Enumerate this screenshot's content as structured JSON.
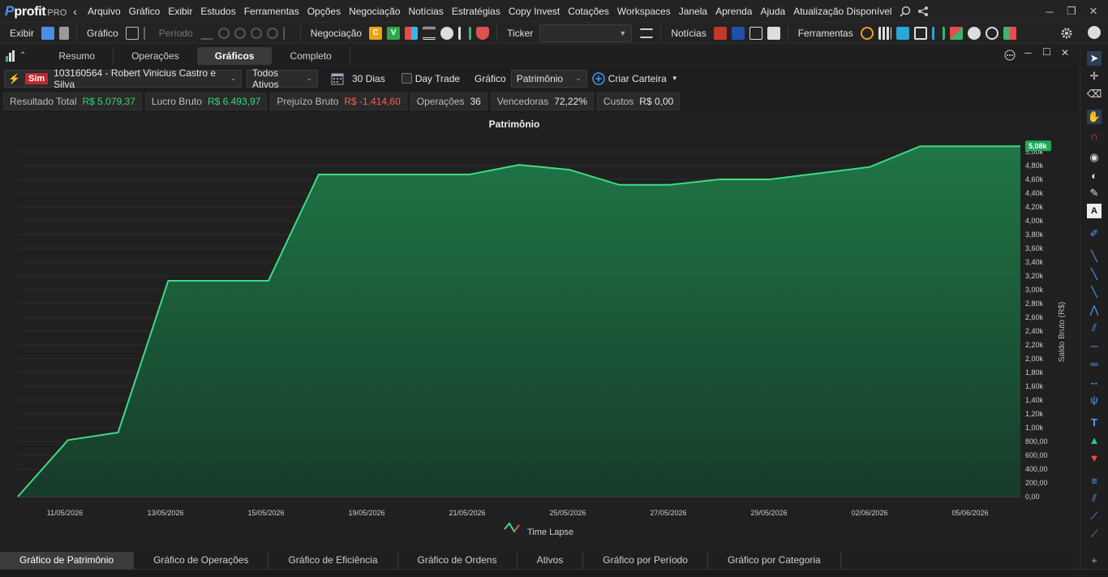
{
  "menubar": {
    "logo_main": "profit",
    "logo_sub": "PRO",
    "items": [
      "Arquivo",
      "Gráfico",
      "Exibir",
      "Estudos",
      "Ferramentas",
      "Opções",
      "Negociação",
      "Notícias",
      "Estratégias",
      "Copy Invest",
      "Cotações",
      "Workspaces",
      "Janela",
      "Aprenda",
      "Ajuda",
      "Atualização Disponível"
    ]
  },
  "toolbar": {
    "exibir": "Exibir",
    "grafico": "Gráfico",
    "periodo": "Período",
    "negociacao": "Negociação",
    "ticker": "Ticker",
    "noticias": "Notícias",
    "ferramentas": "Ferramentas",
    "btn_c": "C",
    "btn_v": "V"
  },
  "tabs": [
    "Resumo",
    "Operações",
    "Gráficos",
    "Completo"
  ],
  "active_tab": "Gráficos",
  "filters": {
    "sim": "Sim",
    "account": "103160564 - Robert Vinicius Castro e Silva",
    "assets": "Todos Ativos",
    "period": "30 Dias",
    "daytrade": "Day Trade",
    "grafico_label": "Gráfico",
    "grafico_value": "Patrimônio",
    "criar": "Criar Carteira"
  },
  "stats": [
    {
      "label": "Resultado Total",
      "value": "R$ 5.079,37",
      "color": "green"
    },
    {
      "label": "Lucro Bruto",
      "value": "R$ 6.493,97",
      "color": "green"
    },
    {
      "label": "Prejuízo Bruto",
      "value": "R$ -1.414,60",
      "color": "red"
    },
    {
      "label": "Operações",
      "value": "36",
      "color": "white"
    },
    {
      "label": "Vencedoras",
      "value": "72,22%",
      "color": "white"
    },
    {
      "label": "Custos",
      "value": "R$ 0,00",
      "color": "white"
    }
  ],
  "chart_data": {
    "type": "area",
    "title": "Patrimônio",
    "ylabel": "Saldo Bruto (R$)",
    "legend": "Time Lapse",
    "last_value_label": "5,08k",
    "ylim": [
      0,
      5000
    ],
    "y_ticks": [
      "0,00",
      "200,00",
      "400,00",
      "600,00",
      "800,00",
      "1,00k",
      "1,20k",
      "1,40k",
      "1,60k",
      "1,80k",
      "2,00k",
      "2,20k",
      "2,40k",
      "2,60k",
      "2,80k",
      "3,00k",
      "3,20k",
      "3,40k",
      "3,60k",
      "3,80k",
      "4,00k",
      "4,20k",
      "4,40k",
      "4,60k",
      "4,80k",
      "5,00k"
    ],
    "x_ticks": [
      "11/05/2026",
      "13/05/2026",
      "15/05/2026",
      "19/05/2026",
      "21/05/2026",
      "25/05/2026",
      "27/05/2026",
      "29/05/2026",
      "02/06/2026",
      "05/06/2026"
    ],
    "series": [
      {
        "values": [
          0,
          820,
          930,
          3130,
          3130,
          3130,
          4670,
          4670,
          4670,
          4670,
          4810,
          4740,
          4520,
          4520,
          4600,
          4600,
          4690,
          4780,
          5080,
          5080,
          5080
        ]
      }
    ],
    "colors": {
      "line": "#3ddc84",
      "fill": "#1e6b43",
      "label_bg": "#1fa85a"
    }
  },
  "bottom_tabs": [
    "Gráfico de Patrimônio",
    "Gráfico de Operações",
    "Gráfico de Eficiência",
    "Gráfico de Ordens",
    "Ativos",
    "Gráfico por Período",
    "Gráfico por Categoria"
  ]
}
